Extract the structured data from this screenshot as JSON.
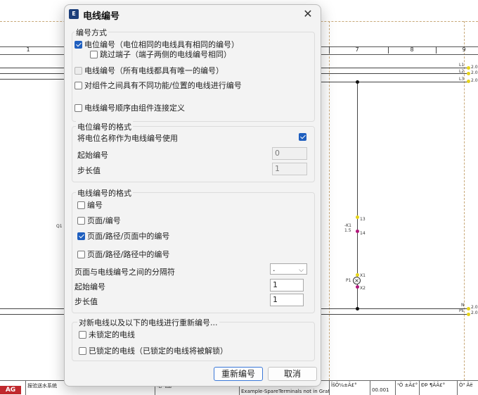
{
  "background": {
    "column_numbers": [
      "1",
      "7",
      "8",
      "9"
    ],
    "right_labels": [
      "L1",
      "L2",
      "L3",
      "N",
      "PE"
    ],
    "right_values": [
      "2.0",
      "2.0",
      "2.0",
      "2.0",
      "2.0"
    ],
    "q_label": "Q1",
    "k_label": "-K1",
    "k_sub": "1.5",
    "p_label": "P1",
    "wire_labels": [
      "13",
      "14",
      "X1",
      "X2"
    ],
    "footer": {
      "cell1": "报验送水系统",
      "cell2": "电气图",
      "cell3": "Example-SpareTerminals not in Gratio",
      "cell4": "ÎšÕ¼±Ã£°",
      "cell5": "00.001",
      "cell6": "¹Ö ±Ã£°",
      "cell7": "ÐÞ ¶ÄÃ£°",
      "cell8": "Ò³ Âë"
    },
    "colors": {
      "node_yellow": "#e6d31a",
      "node_magenta": "#b0187a",
      "logo_red": "#c0282d"
    }
  },
  "dialog": {
    "title": "电线编号",
    "app_icon": "eplan-icon",
    "close_icon": "close-icon",
    "section1": {
      "title": "编号方式",
      "opt_potential": {
        "label": "电位编号（电位相同的电线具有相同的编号）",
        "checked": true
      },
      "opt_skip_terminal": {
        "label": "跳过端子（端子两侧的电线编号相同）",
        "checked": false
      },
      "opt_wire": {
        "label": "电线编号（所有电线都具有唯一的编号）",
        "checked": false,
        "disabled": true
      },
      "opt_function": {
        "label": "对组件之间具有不同功能/位置的电线进行编号",
        "checked": false
      },
      "opt_order": {
        "label": "电线编号顺序由组件连接定义",
        "checked": false
      }
    },
    "section2": {
      "title": "电位编号的格式",
      "use_potential_name_label": "将电位名称作为电线编号使用",
      "use_potential_name_checked": true,
      "start_label": "起始编号",
      "start_value": "0",
      "step_label": "步长值",
      "step_value": "1"
    },
    "section3": {
      "title": "电线编号的格式",
      "opt_number": {
        "label": "编号",
        "checked": false
      },
      "opt_page_number": {
        "label": "页面/编号",
        "checked": false
      },
      "opt_page_path_page": {
        "label": "页面/路径/页面中的编号",
        "checked": true
      },
      "opt_page_path_path": {
        "label": "页面/路径/路径中的编号",
        "checked": false
      },
      "separator_label": "页面与电线编号之间的分隔符",
      "separator_value": ".",
      "start_label": "起始编号",
      "start_value": "1",
      "step_label": "步长值",
      "step_value": "1"
    },
    "section4": {
      "title": "对新电线以及以下的电线进行重新编号...",
      "opt_unlocked": {
        "label": "未锁定的电线",
        "checked": false
      },
      "opt_locked": {
        "label": "已锁定的电线（已锁定的电线将被解锁）",
        "checked": false
      }
    },
    "buttons": {
      "renumber": "重新编号",
      "cancel": "取消"
    }
  }
}
